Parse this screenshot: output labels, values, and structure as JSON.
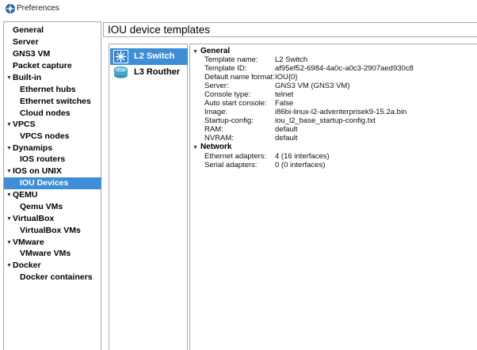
{
  "window": {
    "title": "Preferences"
  },
  "sidebar": {
    "items": [
      {
        "label": "General",
        "level": 0,
        "expanded": null,
        "selected": false
      },
      {
        "label": "Server",
        "level": 0,
        "expanded": null,
        "selected": false
      },
      {
        "label": "GNS3 VM",
        "level": 0,
        "expanded": null,
        "selected": false
      },
      {
        "label": "Packet capture",
        "level": 0,
        "expanded": null,
        "selected": false
      },
      {
        "label": "Built-in",
        "level": 0,
        "expanded": true,
        "selected": false
      },
      {
        "label": "Ethernet hubs",
        "level": 1,
        "expanded": null,
        "selected": false
      },
      {
        "label": "Ethernet switches",
        "level": 1,
        "expanded": null,
        "selected": false
      },
      {
        "label": "Cloud nodes",
        "level": 1,
        "expanded": null,
        "selected": false
      },
      {
        "label": "VPCS",
        "level": 0,
        "expanded": true,
        "selected": false
      },
      {
        "label": "VPCS nodes",
        "level": 1,
        "expanded": null,
        "selected": false
      },
      {
        "label": "Dynamips",
        "level": 0,
        "expanded": true,
        "selected": false
      },
      {
        "label": "IOS routers",
        "level": 1,
        "expanded": null,
        "selected": false
      },
      {
        "label": "IOS on UNIX",
        "level": 0,
        "expanded": true,
        "selected": false
      },
      {
        "label": "IOU Devices",
        "level": 1,
        "expanded": null,
        "selected": true
      },
      {
        "label": "QEMU",
        "level": 0,
        "expanded": true,
        "selected": false
      },
      {
        "label": "Qemu VMs",
        "level": 1,
        "expanded": null,
        "selected": false
      },
      {
        "label": "VirtualBox",
        "level": 0,
        "expanded": true,
        "selected": false
      },
      {
        "label": "VirtualBox VMs",
        "level": 1,
        "expanded": null,
        "selected": false
      },
      {
        "label": "VMware",
        "level": 0,
        "expanded": true,
        "selected": false
      },
      {
        "label": "VMware VMs",
        "level": 1,
        "expanded": null,
        "selected": false
      },
      {
        "label": "Docker",
        "level": 0,
        "expanded": true,
        "selected": false
      },
      {
        "label": "Docker containers",
        "level": 1,
        "expanded": null,
        "selected": false
      }
    ]
  },
  "main": {
    "title": "IOU device templates",
    "templates": [
      {
        "label": "L2 Switch",
        "icon": "switch-icon",
        "selected": true
      },
      {
        "label": "L3 Routher",
        "icon": "router-icon",
        "selected": false
      }
    ],
    "details": {
      "sections": [
        {
          "title": "General",
          "rows": [
            {
              "key": "Template name:",
              "value": "L2 Switch"
            },
            {
              "key": "Template ID:",
              "value": "af95ef52-6984-4a0c-a0c3-2907aed930c8"
            },
            {
              "key": "Default name format:",
              "value": "IOU{0}"
            },
            {
              "key": "Server:",
              "value": "GNS3 VM (GNS3 VM)"
            },
            {
              "key": "Console type:",
              "value": "telnet"
            },
            {
              "key": "Auto start console:",
              "value": "False"
            },
            {
              "key": "Image:",
              "value": "i86bi-linux-l2-adventerprisek9-15.2a.bin"
            },
            {
              "key": "Startup-config:",
              "value": "iou_l2_base_startup-config.txt"
            },
            {
              "key": "RAM:",
              "value": "default"
            },
            {
              "key": "NVRAM:",
              "value": "default"
            }
          ]
        },
        {
          "title": "Network",
          "rows": [
            {
              "key": "Ethernet adapters:",
              "value": "4 (16 interfaces)"
            },
            {
              "key": "Serial adapters:",
              "value": "0 (0 interfaces)"
            }
          ]
        }
      ]
    }
  },
  "colors": {
    "selection": "#3d8ed6",
    "border": "#a8a8a8"
  }
}
